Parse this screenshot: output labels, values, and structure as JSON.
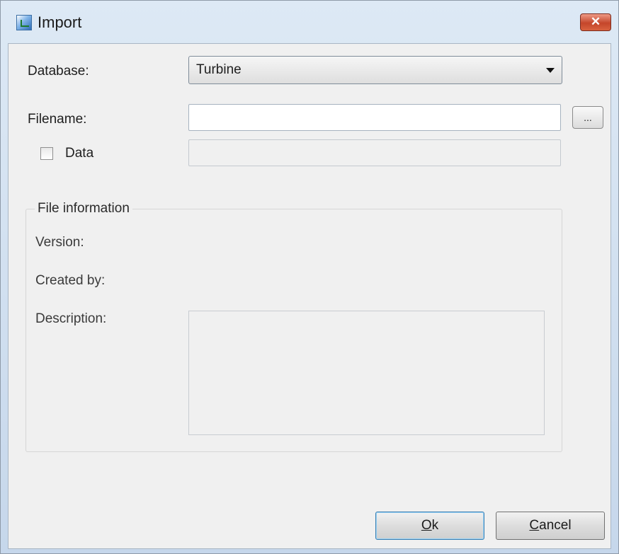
{
  "window": {
    "title": "Import",
    "close_label": "✕"
  },
  "form": {
    "database_label": "Database:",
    "database_value": "Turbine",
    "filename_label": "Filename:",
    "filename_value": "",
    "browse_label": "...",
    "data_label": "Data",
    "data_checked": false,
    "data_value": ""
  },
  "file_information": {
    "legend": "File information",
    "version_label": "Version:",
    "created_by_label": "Created by:",
    "description_label": "Description:",
    "description_value": ""
  },
  "buttons": {
    "ok_mnemonic": "O",
    "ok_rest": "k",
    "cancel_mnemonic": "C",
    "cancel_rest": "ancel"
  },
  "colors": {
    "client_bg": "#f0f0f0",
    "titlebar": "#c6d7eb",
    "close": "#c5462b",
    "ok_border": "#3c7fb1"
  }
}
